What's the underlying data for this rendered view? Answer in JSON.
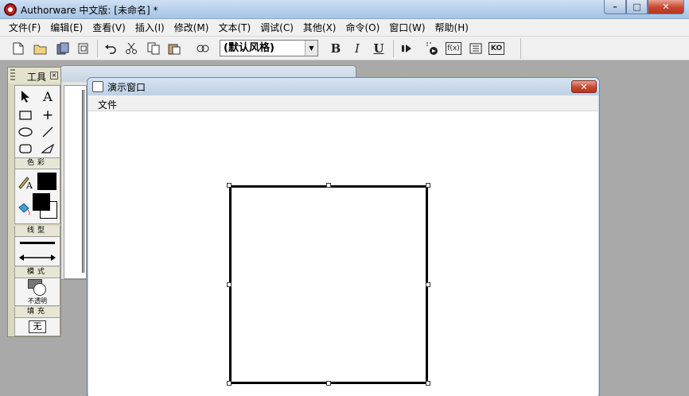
{
  "window": {
    "title": "Authorware 中文版: [未命名] *",
    "minimize_glyph": "–",
    "maximize_glyph": "□",
    "close_glyph": "✕"
  },
  "menu": [
    "文件(F)",
    "编辑(E)",
    "查看(V)",
    "插入(I)",
    "修改(M)",
    "文本(T)",
    "调试(C)",
    "其他(X)",
    "命令(O)",
    "窗口(W)",
    "帮助(H)"
  ],
  "toolbar": {
    "style_select_value": "(默认风格)",
    "bold_label": "B",
    "italic_label": "I",
    "underline_label": "U",
    "functions_label": "f(x)",
    "knowledge_label": "KO"
  },
  "tool_palette": {
    "title": "工具",
    "color_label": "色彩",
    "line_label": "线型",
    "mode_label": "模式",
    "mode_value": "不透明",
    "fill_label": "填充",
    "fill_value": "无"
  },
  "presentation_window": {
    "title": "演示窗口",
    "menu_file": "文件",
    "close_glyph": "✕"
  },
  "colors": {
    "foreground_color": "#000000",
    "accent_close": "#c7462f"
  }
}
